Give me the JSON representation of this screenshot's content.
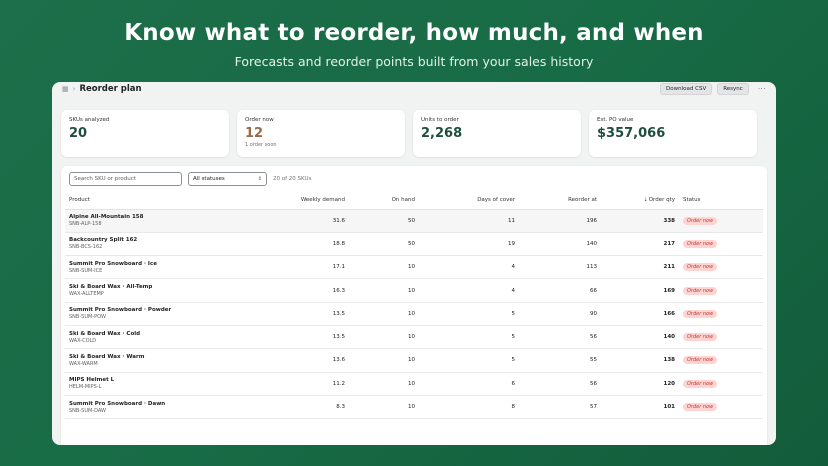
{
  "hero": {
    "title": "Know what to reorder, how much, and when",
    "subtitle": "Forecasts and reorder points built from your sales history"
  },
  "topbar": {
    "breadcrumb_icon": "grid-icon",
    "title": "Reorder plan",
    "download_label": "Download CSV",
    "resync_label": "Resync",
    "more_label": "···"
  },
  "cards": [
    {
      "label": "SKUs analyzed",
      "value": "20",
      "note": ""
    },
    {
      "label": "Order now",
      "value": "12",
      "note": "1 order soon"
    },
    {
      "label": "Units to order",
      "value": "2,268",
      "note": ""
    },
    {
      "label": "Est. PO value",
      "value": "$357,066",
      "note": ""
    }
  ],
  "filters": {
    "search_placeholder": "Search SKU or product",
    "status_value": "All statuses",
    "count_text": "20 of 20 SKUs"
  },
  "table": {
    "headers": {
      "product": "Product",
      "weekly": "Weekly demand",
      "onhand": "On hand",
      "cover": "Days of cover",
      "reorder": "Reorder at",
      "qty": "Order qty",
      "status": "Status"
    },
    "rows": [
      {
        "name": "Alpine All-Mountain 158",
        "sku": "SNB-ALP-158",
        "weekly": "31.6",
        "onhand": "50",
        "cover": "11",
        "reorder": "196",
        "qty": "338",
        "status": "Order now"
      },
      {
        "name": "Backcountry Split 162",
        "sku": "SNB-BCS-162",
        "weekly": "18.8",
        "onhand": "50",
        "cover": "19",
        "reorder": "140",
        "qty": "217",
        "status": "Order now"
      },
      {
        "name": "Summit Pro Snowboard · Ice",
        "sku": "SNB-SUM-ICE",
        "weekly": "17.1",
        "onhand": "10",
        "cover": "4",
        "reorder": "113",
        "qty": "211",
        "status": "Order now"
      },
      {
        "name": "Ski & Board Wax · All-Temp",
        "sku": "WAX-ALLTEMP",
        "weekly": "16.3",
        "onhand": "10",
        "cover": "4",
        "reorder": "66",
        "qty": "169",
        "status": "Order now"
      },
      {
        "name": "Summit Pro Snowboard · Powder",
        "sku": "SNB-SUM-POW",
        "weekly": "13.5",
        "onhand": "10",
        "cover": "5",
        "reorder": "90",
        "qty": "166",
        "status": "Order now"
      },
      {
        "name": "Ski & Board Wax · Cold",
        "sku": "WAX-COLD",
        "weekly": "13.5",
        "onhand": "10",
        "cover": "5",
        "reorder": "56",
        "qty": "140",
        "status": "Order now"
      },
      {
        "name": "Ski & Board Wax · Warm",
        "sku": "WAX-WARM",
        "weekly": "13.6",
        "onhand": "10",
        "cover": "5",
        "reorder": "55",
        "qty": "138",
        "status": "Order now"
      },
      {
        "name": "MIPS Helmet L",
        "sku": "HELM-MIPS-L",
        "weekly": "11.2",
        "onhand": "10",
        "cover": "6",
        "reorder": "56",
        "qty": "120",
        "status": "Order now"
      },
      {
        "name": "Summit Pro Snowboard · Dawn",
        "sku": "SNB-SUM-DAW",
        "weekly": "8.3",
        "onhand": "10",
        "cover": "8",
        "reorder": "57",
        "qty": "101",
        "status": "Order now"
      }
    ]
  },
  "colors": {
    "background": "#176b45",
    "accent_value": "#1f4e3d",
    "warn_value": "#9a6a45",
    "badge_bg": "#fed3d1",
    "badge_text": "#c23b2e"
  }
}
